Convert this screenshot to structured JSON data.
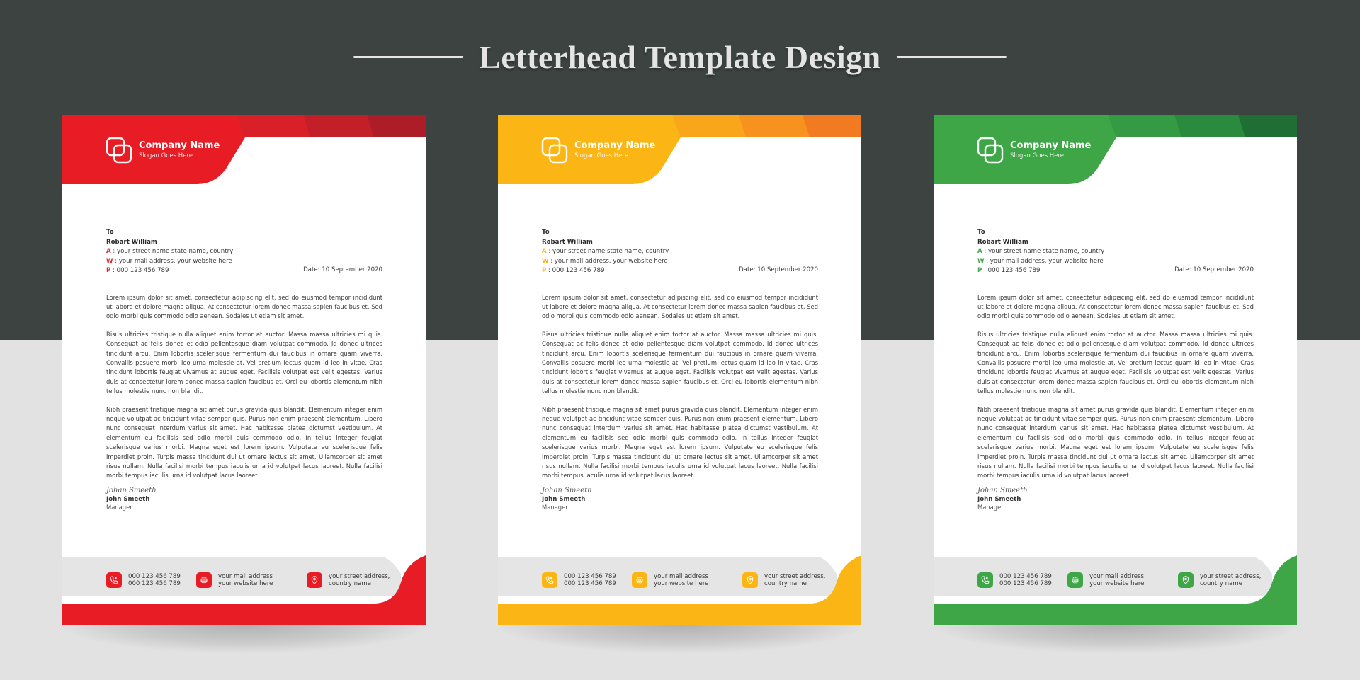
{
  "header": {
    "title": "Letterhead Template Design"
  },
  "letterheads": [
    {
      "variant": "red",
      "colors": {
        "primary": "#e81c24",
        "band1": "#d91f27",
        "band2": "#c21f28",
        "band3": "#ad1d28",
        "label": "#e81c24"
      },
      "company_name": "Company Name",
      "slogan": "Slogan Goes Here",
      "recipient": {
        "to": "To",
        "name": "Robart William",
        "address_label": "A",
        "address": " : your street name state name, country",
        "web_label": "W",
        "web": " : your mail address, your website here",
        "phone_label": "P",
        "phone": " : 000 123 456 789"
      },
      "date": "Date: 10 September 2020",
      "paragraphs": [
        "Lorem ipsum dolor sit amet, consectetur adipiscing elit, sed do eiusmod tempor incididunt ut labore et dolore magna aliqua. At consectetur lorem donec massa sapien faucibus et. Sed odio morbi quis commodo odio aenean. Sodales ut etiam sit amet.",
        "Risus ultricies tristique nulla aliquet enim tortor at auctor. Massa massa ultricies mi quis. Consequat ac felis donec et odio pellentesque diam volutpat commodo. Id donec ultrices tincidunt arcu. Enim lobortis scelerisque fermentum dui faucibus in ornare quam viverra. Convallis posuere morbi leo urna molestie at. Vel pretium lectus quam id leo in vitae. Cras tincidunt lobortis feugiat vivamus at augue eget. Facilisis volutpat est velit egestas. Varius duis at consectetur lorem donec massa sapien faucibus et. Orci eu lobortis elementum nibh tellus molestie nunc non blandit.",
        "Nibh praesent tristique magna sit amet purus gravida quis blandit. Elementum integer enim neque volutpat ac tincidunt vitae semper quis. Purus non enim praesent elementum. Libero nunc consequat interdum varius sit amet. Hac habitasse platea dictumst vestibulum. At elementum eu facilisis sed odio morbi quis commodo odio. In tellus integer feugiat scelerisque varius morbi. Magna eget est lorem ipsum. Vulputate eu scelerisque felis imperdiet proin. Turpis massa tincidunt dui ut ornare lectus sit amet. Ullamcorper sit amet risus nullam. Nulla facilisi morbi tempus iaculis urna id volutpat lacus laoreet. Nulla facilisi morbi tempus iaculis urna id volutpat lacus laoreet."
      ],
      "signature": "Johan Smeeth",
      "signer_name": "John Smeeth",
      "signer_role": "Manager",
      "footer": {
        "phone_icon": "phone-icon",
        "phone_line1": "000 123 456 789",
        "phone_line2": "000 123 456 789",
        "web_icon": "globe-icon",
        "web_line1": "your mail address",
        "web_line2": "your website here",
        "address_icon": "location-pin-icon",
        "address_line1": "your street address,",
        "address_line2": "country name"
      }
    },
    {
      "variant": "yellow",
      "colors": {
        "primary": "#fbb616",
        "band1": "#f9a61b",
        "band2": "#f7921e",
        "band3": "#f27a21",
        "label": "#fbb616"
      },
      "company_name": "Company Name",
      "slogan": "Slogan Goes Here",
      "recipient": {
        "to": "To",
        "name": "Robart William",
        "address_label": "A",
        "address": " : your street name state name, country",
        "web_label": "W",
        "web": " : your mail address, your website here",
        "phone_label": "P",
        "phone": " : 000 123 456 789"
      },
      "date": "Date: 10 September 2020",
      "paragraphs": [
        "Lorem ipsum dolor sit amet, consectetur adipiscing elit, sed do eiusmod tempor incididunt ut labore et dolore magna aliqua. At consectetur lorem donec massa sapien faucibus et. Sed odio morbi quis commodo odio aenean. Sodales ut etiam sit amet.",
        "Risus ultricies tristique nulla aliquet enim tortor at auctor. Massa massa ultricies mi quis. Consequat ac felis donec et odio pellentesque diam volutpat commodo. Id donec ultrices tincidunt arcu. Enim lobortis scelerisque fermentum dui faucibus in ornare quam viverra. Convallis posuere morbi leo urna molestie at. Vel pretium lectus quam id leo in vitae. Cras tincidunt lobortis feugiat vivamus at augue eget. Facilisis volutpat est velit egestas. Varius duis at consectetur lorem donec massa sapien faucibus et. Orci eu lobortis elementum nibh tellus molestie nunc non blandit.",
        "Nibh praesent tristique magna sit amet purus gravida quis blandit. Elementum integer enim neque volutpat ac tincidunt vitae semper quis. Purus non enim praesent elementum. Libero nunc consequat interdum varius sit amet. Hac habitasse platea dictumst vestibulum. At elementum eu facilisis sed odio morbi quis commodo odio. In tellus integer feugiat scelerisque varius morbi. Magna eget est lorem ipsum. Vulputate eu scelerisque felis imperdiet proin. Turpis massa tincidunt dui ut ornare lectus sit amet. Ullamcorper sit amet risus nullam. Nulla facilisi morbi tempus iaculis urna id volutpat lacus laoreet. Nulla facilisi morbi tempus iaculis urna id volutpat lacus laoreet."
      ],
      "signature": "Johan Smeeth",
      "signer_name": "John Smeeth",
      "signer_role": "Manager",
      "footer": {
        "phone_icon": "phone-icon",
        "phone_line1": "000 123 456 789",
        "phone_line2": "000 123 456 789",
        "web_icon": "globe-icon",
        "web_line1": "your mail address",
        "web_line2": "your website here",
        "address_icon": "location-pin-icon",
        "address_line1": "your street address,",
        "address_line2": "country name"
      }
    },
    {
      "variant": "green",
      "colors": {
        "primary": "#3fa648",
        "band1": "#349a44",
        "band2": "#2a8a3e",
        "band3": "#1f6f35",
        "label": "#3fa648"
      },
      "company_name": "Company Name",
      "slogan": "Slogan Goes Here",
      "recipient": {
        "to": "To",
        "name": "Robart William",
        "address_label": "A",
        "address": " : your street name state name, country",
        "web_label": "W",
        "web": " : your mail address, your website here",
        "phone_label": "P",
        "phone": " : 000 123 456 789"
      },
      "date": "Date: 10 September 2020",
      "paragraphs": [
        "Lorem ipsum dolor sit amet, consectetur adipiscing elit, sed do eiusmod tempor incididunt ut labore et dolore magna aliqua. At consectetur lorem donec massa sapien faucibus et. Sed odio morbi quis commodo odio aenean. Sodales ut etiam sit amet.",
        "Risus ultricies tristique nulla aliquet enim tortor at auctor. Massa massa ultricies mi quis. Consequat ac felis donec et odio pellentesque diam volutpat commodo. Id donec ultrices tincidunt arcu. Enim lobortis scelerisque fermentum dui faucibus in ornare quam viverra. Convallis posuere morbi leo urna molestie at. Vel pretium lectus quam id leo in vitae. Cras tincidunt lobortis feugiat vivamus at augue eget. Facilisis volutpat est velit egestas. Varius duis at consectetur lorem donec massa sapien faucibus et. Orci eu lobortis elementum nibh tellus molestie nunc non blandit.",
        "Nibh praesent tristique magna sit amet purus gravida quis blandit. Elementum integer enim neque volutpat ac tincidunt vitae semper quis. Purus non enim praesent elementum. Libero nunc consequat interdum varius sit amet. Hac habitasse platea dictumst vestibulum. At elementum eu facilisis sed odio morbi quis commodo odio. In tellus integer feugiat scelerisque varius morbi. Magna eget est lorem ipsum. Vulputate eu scelerisque felis imperdiet proin. Turpis massa tincidunt dui ut ornare lectus sit amet. Ullamcorper sit amet risus nullam. Nulla facilisi morbi tempus iaculis urna id volutpat lacus laoreet. Nulla facilisi morbi tempus iaculis urna id volutpat lacus laoreet."
      ],
      "signature": "Johan Smeeth",
      "signer_name": "John Smeeth",
      "signer_role": "Manager",
      "footer": {
        "phone_icon": "phone-icon",
        "phone_line1": "000 123 456 789",
        "phone_line2": "000 123 456 789",
        "web_icon": "globe-icon",
        "web_line1": "your mail address",
        "web_line2": "your website here",
        "address_icon": "location-pin-icon",
        "address_line1": "your street address,",
        "address_line2": "country name"
      }
    }
  ]
}
